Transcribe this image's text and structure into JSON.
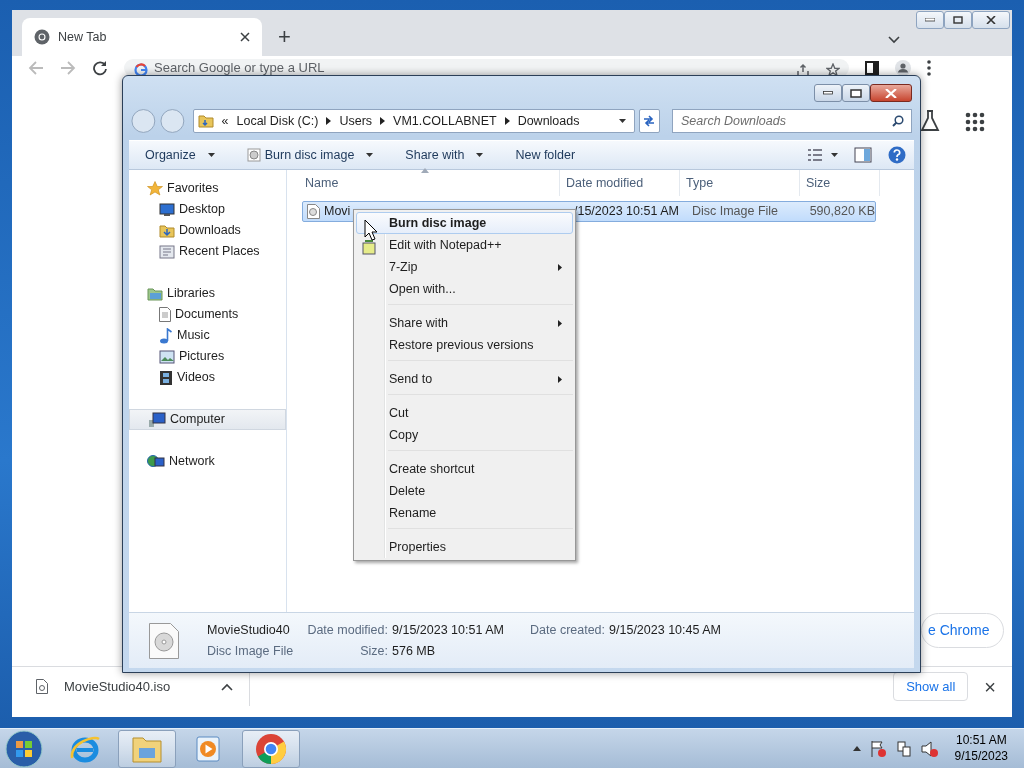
{
  "browser": {
    "tabs": [
      {
        "title": "New Tab",
        "selected": true
      }
    ],
    "new_tab": "+",
    "omnibox": {
      "placeholder": "Search Google or type a URL"
    },
    "customize_button": "e Chrome",
    "download_bar": {
      "items": [
        {
          "file": "MovieStudio40.iso"
        }
      ],
      "show_all": "Show all",
      "close": "×"
    }
  },
  "explorer": {
    "address": [
      "«",
      "Local Disk (C:)",
      "Users",
      "VM1.COLLABNET",
      "Downloads"
    ],
    "search": {
      "placeholder": "Search Downloads"
    },
    "toolbar": [
      {
        "label": "Organize",
        "dropdown": true
      },
      {
        "label": "Burn disc image",
        "dropdown": true
      },
      {
        "label": "Share with",
        "dropdown": true
      },
      {
        "label": "New folder",
        "dropdown": false
      }
    ],
    "nav": [
      {
        "label": "Favorites",
        "selected": false,
        "children": [
          {
            "label": "Desktop",
            "selected": false
          },
          {
            "label": "Downloads",
            "selected": false
          },
          {
            "label": "Recent Places",
            "selected": false
          }
        ]
      },
      {
        "label": "Libraries",
        "selected": false,
        "children": [
          {
            "label": "Documents",
            "selected": false
          },
          {
            "label": "Music",
            "selected": false
          },
          {
            "label": "Pictures",
            "selected": false
          },
          {
            "label": "Videos",
            "selected": false
          }
        ]
      },
      {
        "label": "Computer",
        "selected": true
      },
      {
        "label": "Network",
        "selected": false
      }
    ],
    "columns": [
      {
        "label": "Name",
        "sorted": true
      },
      {
        "label": "Date modified",
        "sorted": false
      },
      {
        "label": "Type",
        "sorted": false
      },
      {
        "label": "Size",
        "sorted": false
      }
    ],
    "files": [
      {
        "name": "Movi",
        "date_modified": "/15/2023 10:51 AM",
        "type": "Disc Image File",
        "size": "590,820 KB",
        "selected": true
      }
    ],
    "details": {
      "name": "MovieStudio40",
      "type": "Disc Image File",
      "fields": [
        {
          "label": "Date modified:",
          "value": "9/15/2023 10:51 AM"
        },
        {
          "label": "Date created:",
          "value": "9/15/2023 10:45 AM"
        },
        {
          "label": "Size:",
          "value": "576 MB"
        }
      ]
    }
  },
  "context_menu": [
    {
      "kind": "item",
      "label": "Burn disc image",
      "default": true,
      "selected": true,
      "submenu": false
    },
    {
      "kind": "item",
      "label": "Edit with Notepad++",
      "default": false,
      "selected": false,
      "submenu": false
    },
    {
      "kind": "item",
      "label": "7-Zip",
      "default": false,
      "selected": false,
      "submenu": true
    },
    {
      "kind": "item",
      "label": "Open with...",
      "default": false,
      "selected": false,
      "submenu": false
    },
    {
      "kind": "separator"
    },
    {
      "kind": "item",
      "label": "Share with",
      "default": false,
      "selected": false,
      "submenu": true
    },
    {
      "kind": "item",
      "label": "Restore previous versions",
      "default": false,
      "selected": false,
      "submenu": false
    },
    {
      "kind": "separator"
    },
    {
      "kind": "item",
      "label": "Send to",
      "default": false,
      "selected": false,
      "submenu": true
    },
    {
      "kind": "separator"
    },
    {
      "kind": "item",
      "label": "Cut",
      "default": false,
      "selected": false,
      "submenu": false
    },
    {
      "kind": "item",
      "label": "Copy",
      "default": false,
      "selected": false,
      "submenu": false
    },
    {
      "kind": "separator"
    },
    {
      "kind": "item",
      "label": "Create shortcut",
      "default": false,
      "selected": false,
      "submenu": false
    },
    {
      "kind": "item",
      "label": "Delete",
      "default": false,
      "selected": false,
      "submenu": false
    },
    {
      "kind": "item",
      "label": "Rename",
      "default": false,
      "selected": false,
      "submenu": false
    },
    {
      "kind": "separator"
    },
    {
      "kind": "item",
      "label": "Properties",
      "default": false,
      "selected": false,
      "submenu": false
    }
  ],
  "taskbar": {
    "apps": [
      {
        "open": false
      },
      {
        "open": true
      },
      {
        "open": false
      },
      {
        "open": true
      }
    ],
    "clock": {
      "time": "10:51 AM",
      "date": "9/15/2023"
    }
  }
}
